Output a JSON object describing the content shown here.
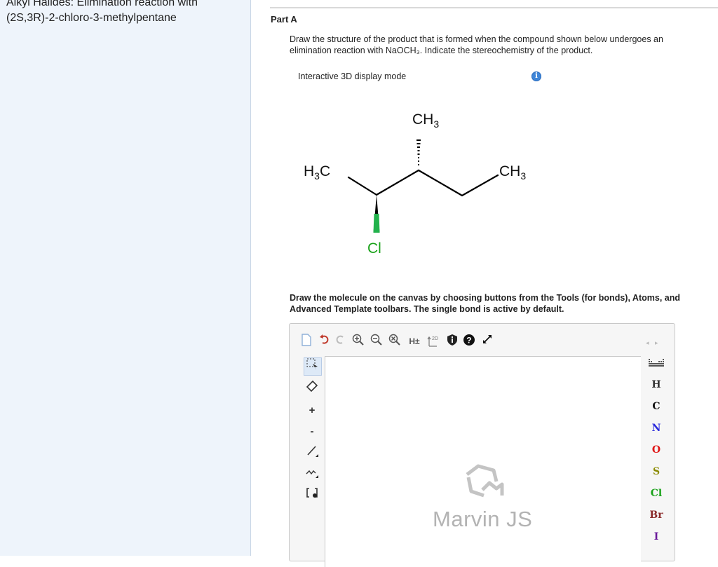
{
  "sidebar": {
    "title": "Alkyl Halides: Elimination reaction with",
    "subtitle": "(2S,3R)-2-chloro-3-methylpentane"
  },
  "part": {
    "label": "Part A",
    "question": "Draw the structure of the product that is formed when the compound shown below undergoes an elimination reaction with NaOCH₃. Indicate the stereochemistry of the product.",
    "display_mode": "Interactive 3D display mode",
    "instructions": "Draw the molecule on the canvas by choosing buttons from the Tools (for bonds), Atoms, and Advanced Template toolbars. The single bond is active by default."
  },
  "molecule": {
    "top_group": "CH",
    "top_group_sub": "3",
    "left_group": "H",
    "left_group_sub": "3",
    "left_group_tail": "C",
    "right_group": "CH",
    "right_group_sub": "3",
    "halogen": "Cl"
  },
  "editor": {
    "top_tools": [
      "new-document",
      "undo",
      "redo",
      "zoom-in",
      "zoom-out",
      "clear",
      "hydrogens",
      "2D-cleaning",
      "info",
      "help",
      "fullscreen"
    ],
    "hydrogen_label": "H±",
    "clean_label": "2D",
    "left_tools": [
      "selection",
      "eraser",
      "increase-charge",
      "decrease-charge",
      "single-bond",
      "chain",
      "brackets"
    ],
    "atoms": [
      {
        "symbol": "H",
        "color": "#333333"
      },
      {
        "symbol": "C",
        "color": "#111111"
      },
      {
        "symbol": "N",
        "color": "#2a2adc"
      },
      {
        "symbol": "O",
        "color": "#e01818"
      },
      {
        "symbol": "S",
        "color": "#8b8b00"
      },
      {
        "symbol": "Cl",
        "color": "#1aa21a"
      },
      {
        "symbol": "Br",
        "color": "#8a2a2a"
      },
      {
        "symbol": "I",
        "color": "#6a1a9a"
      }
    ],
    "watermark": "Marvin JS"
  }
}
